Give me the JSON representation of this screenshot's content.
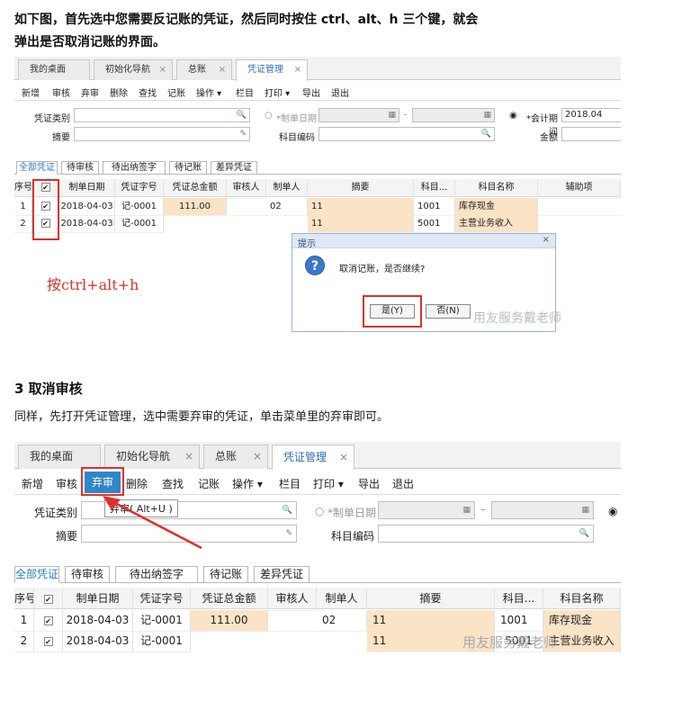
{
  "intro": {
    "line1": "如下图，首先选中您需要反记账的凭证，然后同时按住 ctrl、alt、h 三个键，就会",
    "line2": "弹出是否取消记账的界面。"
  },
  "tabs": {
    "desktop": "我的桌面",
    "init_nav": "初始化导航",
    "ledger": "总账",
    "voucher_mgmt": "凭证管理",
    "close_glyph": "×"
  },
  "toolbar": {
    "new": "新增",
    "review": "审核",
    "abandon": "弃审",
    "delete": "删除",
    "find": "查找",
    "post": "记账",
    "operate": "操作 ▾",
    "columns": "栏目",
    "print": "打印 ▾",
    "export": "导出",
    "exit": "退出"
  },
  "filters": {
    "voucher_type": "凭证类别",
    "summary": "摘要",
    "created_date": "*制单日期",
    "account_code": "科目编码",
    "period": "*会计期间",
    "period_value": "2018.04",
    "amount": "金额",
    "dash": "–"
  },
  "filter_tabs": [
    "全部凭证",
    "待审核",
    "待出纳签字",
    "待记账",
    "差异凭证"
  ],
  "grid": {
    "headers": [
      "序号",
      "",
      "制单日期",
      "凭证字号",
      "凭证总金额",
      "审核人",
      "制单人",
      "摘要",
      "科目...",
      "科目名称",
      "辅助项"
    ],
    "rows": [
      [
        "1",
        "✔",
        "2018-04-03",
        "记-0001",
        "111.00",
        "",
        "02",
        "11",
        "1001",
        "库存现金",
        ""
      ],
      [
        "2",
        "✔",
        "2018-04-03",
        "记-0001",
        "",
        "",
        "",
        "11",
        "5001",
        "主营业务收入",
        ""
      ]
    ]
  },
  "shortcut_note": "按ctrl+alt+h",
  "dialog": {
    "title": "提示",
    "close": "×",
    "icon": "?",
    "message": "取消记账，是否继续?",
    "yes": "是(Y)",
    "no": "否(N)"
  },
  "watermark": "用友服务戴老师",
  "section3": {
    "heading": "3 取消审核",
    "text": "同样，先打开凭证管理，选中需要弃审的凭证，单击菜单里的弃审即可。"
  },
  "tooltip": "弃审( Alt+U )",
  "colors": {
    "accent": "#2f6fb3",
    "highlight_red": "#e0302a",
    "row_peach": "#fbe3c6",
    "note_red": "#e0302a"
  }
}
